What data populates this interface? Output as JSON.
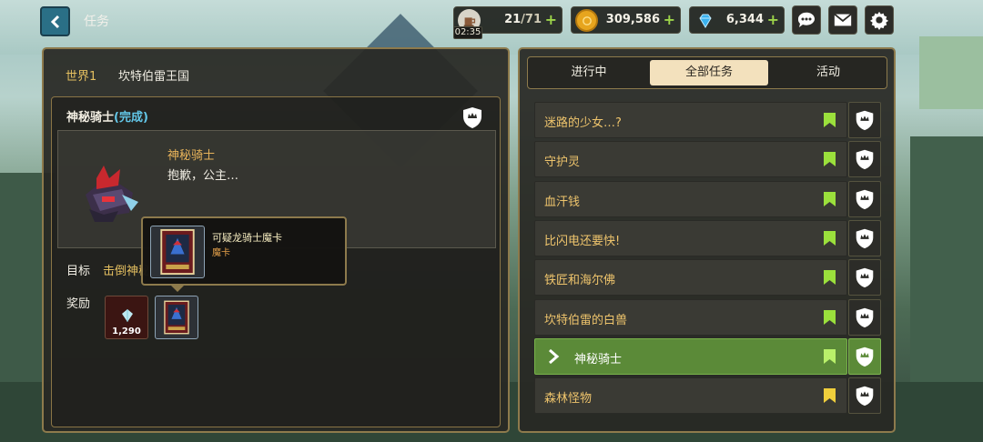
{
  "header": {
    "title": "任务",
    "stamina": {
      "current": "21",
      "max": "/71"
    },
    "stamina_timer": "02:35",
    "gold": "309,586",
    "gems": "6,344",
    "plus_symbol": "+"
  },
  "breadcrumb": {
    "world": "世界1",
    "region": "坎特伯雷王国"
  },
  "quest": {
    "name": "神秘骑士",
    "status": "(完成)",
    "npc_name": "神秘骑士",
    "npc_line": "抱歉，公主…",
    "goal_label": "目标",
    "goal_text": "击倒神秘骑士",
    "reward_label": "奖励",
    "reward_gem_amount": "1,290"
  },
  "tooltip": {
    "item_name": "可疑龙骑士魔卡",
    "item_type": "魔卡"
  },
  "tabs": [
    {
      "label": "进行中",
      "active": false
    },
    {
      "label": "全部任务",
      "active": true
    },
    {
      "label": "活动",
      "active": false
    }
  ],
  "quest_list": [
    {
      "name": "迷路的少女…?",
      "bookmark_color": "#9be03c",
      "selected": false
    },
    {
      "name": "守护灵",
      "bookmark_color": "#9be03c",
      "selected": false
    },
    {
      "name": "血汗钱",
      "bookmark_color": "#9be03c",
      "selected": false
    },
    {
      "name": "比闪电还要快!",
      "bookmark_color": "#9be03c",
      "selected": false
    },
    {
      "name": "铁匠和海尔佛",
      "bookmark_color": "#9be03c",
      "selected": false
    },
    {
      "name": "坎特伯雷的白兽",
      "bookmark_color": "#9be03c",
      "selected": false
    },
    {
      "name": "神秘骑士",
      "bookmark_color": "#b9f06a",
      "selected": true
    },
    {
      "name": "森林怪物",
      "bookmark_color": "#f0cf3c",
      "selected": false
    }
  ],
  "icons": {
    "back": "chevron-left-icon",
    "stamina": "coffee-cup-icon",
    "gold": "gold-coin-icon",
    "gem": "diamond-icon",
    "chat": "chat-bubble-icon",
    "mail": "envelope-icon",
    "settings": "gear-icon",
    "quest_type": "crown-shield-icon",
    "bookmark": "bookmark-icon"
  }
}
